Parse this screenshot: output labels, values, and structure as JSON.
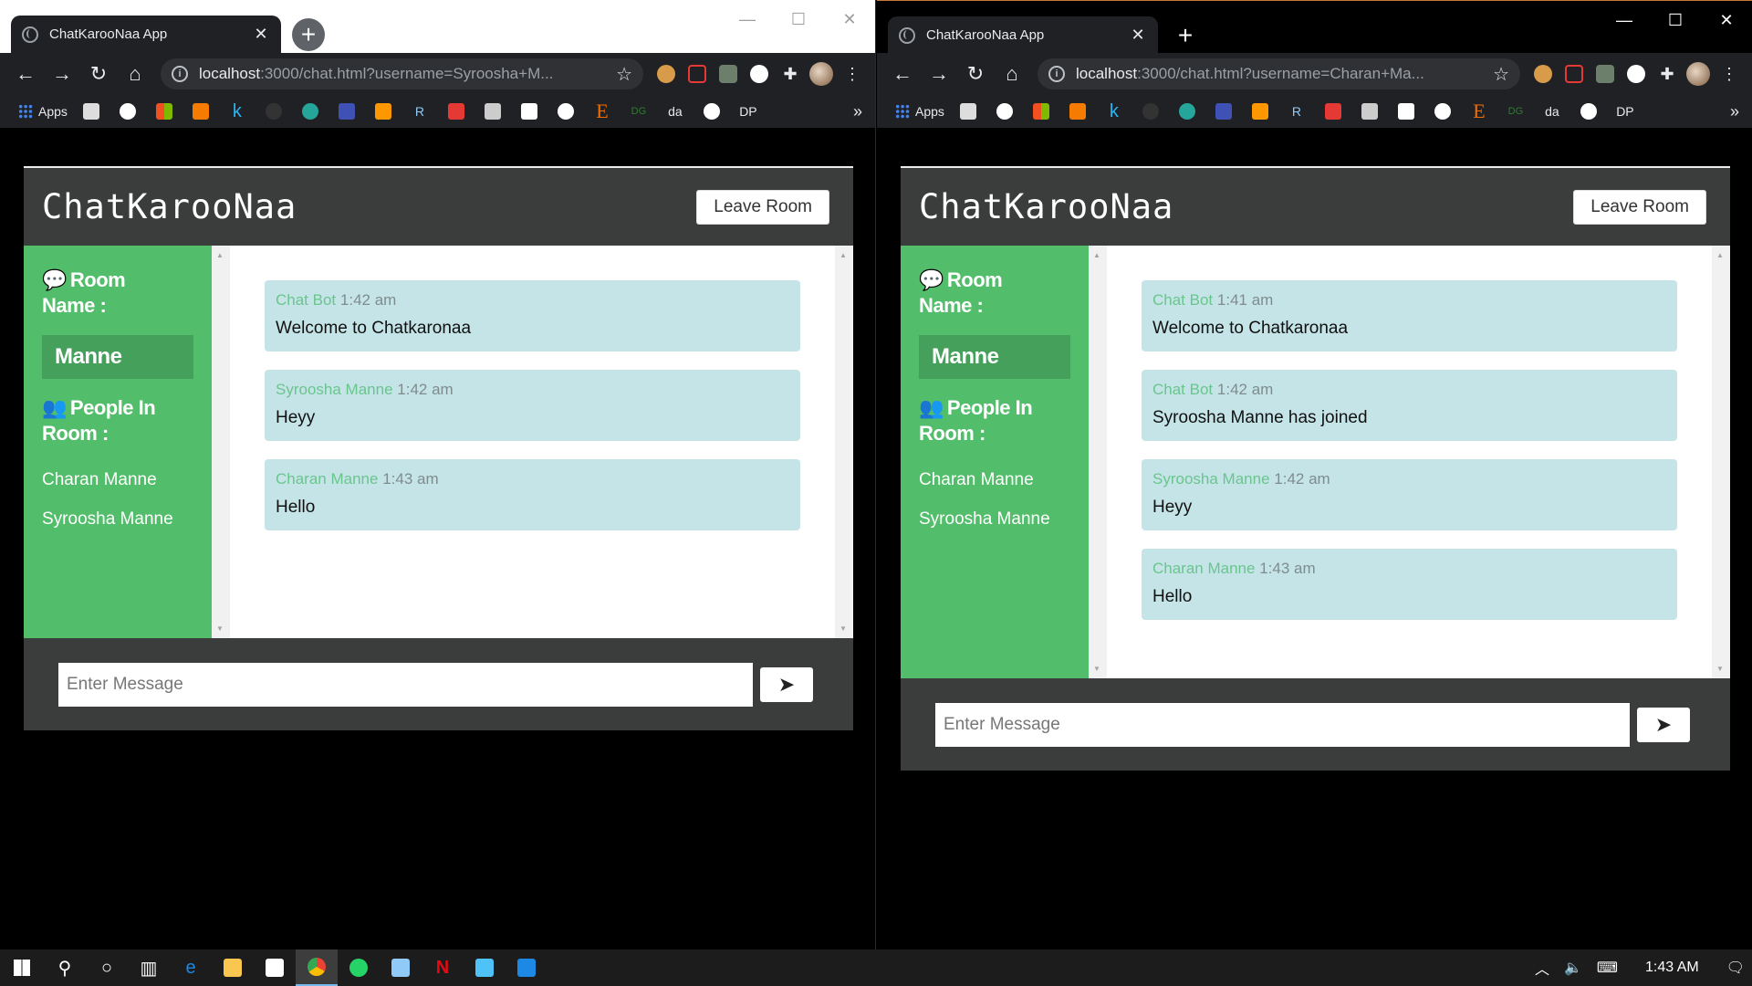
{
  "windows": [
    {
      "tab_title": "ChatKarooNaa App",
      "url_host": "localhost",
      "url_rest": ":3000/chat.html?username=Syroosha+M...",
      "app": {
        "brand": "ChatKarooNaa",
        "leave_label": "Leave Room",
        "room_heading_1": "Room",
        "room_heading_2": "Name :",
        "room_name": "Manne",
        "people_heading_1": "People In",
        "people_heading_2": "Room :",
        "users": [
          "Charan Manne",
          "Syroosha Manne"
        ],
        "messages": [
          {
            "author": "Chat Bot",
            "time": "1:42 am",
            "text": "Welcome to Chatkaronaa"
          },
          {
            "author": "Syroosha Manne",
            "time": "1:42 am",
            "text": "Heyy"
          },
          {
            "author": "Charan Manne",
            "time": "1:43 am",
            "text": "Hello"
          }
        ],
        "input_placeholder": "Enter Message"
      }
    },
    {
      "tab_title": "ChatKarooNaa App",
      "url_host": "localhost",
      "url_rest": ":3000/chat.html?username=Charan+Ma...",
      "app": {
        "brand": "ChatKarooNaa",
        "leave_label": "Leave Room",
        "room_heading_1": "Room",
        "room_heading_2": "Name :",
        "room_name": "Manne",
        "people_heading_1": "People In",
        "people_heading_2": "Room :",
        "users": [
          "Charan Manne",
          "Syroosha Manne"
        ],
        "messages": [
          {
            "author": "Chat Bot",
            "time": "1:41 am",
            "text": "Welcome to Chatkaronaa"
          },
          {
            "author": "Chat Bot",
            "time": "1:42 am",
            "text": "Syroosha Manne has joined"
          },
          {
            "author": "Syroosha Manne",
            "time": "1:42 am",
            "text": "Heyy"
          },
          {
            "author": "Charan Manne",
            "time": "1:43 am",
            "text": "Hello"
          }
        ],
        "input_placeholder": "Enter Message"
      }
    }
  ],
  "bookmarks": {
    "apps": "Apps",
    "da": "da",
    "dp": "DP",
    "dg": "DG",
    "e": "E",
    "k": "k",
    "r": "R"
  },
  "taskbar": {
    "clock": "1:43 AM"
  },
  "colors": {
    "sidebar": "#52bd6a",
    "header": "#3a3d3b",
    "message_bg": "#c5e4e8",
    "author": "#6ac58d"
  }
}
